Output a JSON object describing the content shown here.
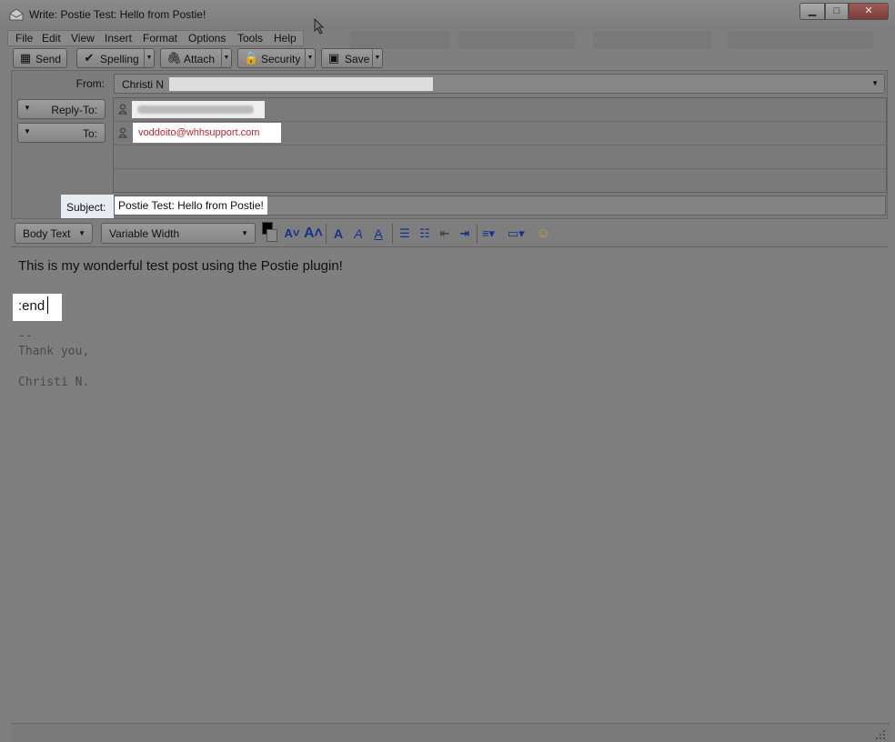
{
  "window": {
    "title": "Write: Postie Test: Hello from Postie!",
    "buttons": {
      "minimize": "▁",
      "maximize": "□",
      "close": "✕"
    }
  },
  "menu": [
    "File",
    "Edit",
    "View",
    "Insert",
    "Format",
    "Options",
    "Tools",
    "Help"
  ],
  "toolbar": {
    "send": "Send",
    "spelling": "Spelling",
    "attach": "Attach",
    "security": "Security",
    "save": "Save"
  },
  "header": {
    "from_label": "From:",
    "from_value": "Christi N",
    "reply_to_label": "Reply-To:",
    "to_label": "To:",
    "to_value": "voddoito@whhsupport.com",
    "subject_label": "Subject:",
    "subject_value": "Postie Test: Hello from Postie!"
  },
  "format_bar": {
    "paragraph_style": "Body Text",
    "font": "Variable Width",
    "icons": [
      "text-color",
      "smaller-font",
      "larger-font",
      "bold",
      "italic",
      "underline",
      "bullet-list",
      "numbered-list",
      "outdent",
      "indent",
      "align",
      "insert-image",
      "insert-smiley"
    ]
  },
  "body": {
    "line1": "This is my wonderful test post using the Postie plugin!",
    "end_marker": ":end",
    "sig_dashes": "--",
    "sig_line1": "Thank you,",
    "sig_line2": "Christi N."
  },
  "colors": {
    "to_address": "#c0232a",
    "format_icons": "#13318a"
  }
}
